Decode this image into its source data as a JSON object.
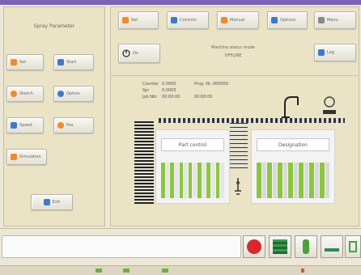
{
  "left_panel": {
    "title": "Spray Parameter",
    "buttons": [
      {
        "label": "Set",
        "icon": "orange-square-icon",
        "color": "#f08a2a"
      },
      {
        "label": "Start",
        "icon": "blue-grid-icon",
        "color": "#3f79c9"
      },
      {
        "label": "Sketch",
        "icon": "orange-half-icon",
        "color": "#f08a2a"
      },
      {
        "label": "Option",
        "icon": "blue-oval-icon",
        "color": "#3f79c9"
      },
      {
        "label": "Speed",
        "icon": "blue-square-icon",
        "color": "#3f79c9"
      },
      {
        "label": "Pos",
        "icon": "orange-dot-icon",
        "color": "#f08a2a"
      },
      {
        "label": "Simulation",
        "icon": "orange-grid-icon",
        "color": "#f08a2a"
      }
    ],
    "bottom_button": "Exit"
  },
  "toolbar": [
    {
      "label": "Set",
      "icon": "orange-icon",
      "color": "#f08a2a"
    },
    {
      "label": "Controls",
      "icon": "blue-icon",
      "color": "#3f79c9"
    },
    {
      "label": "Manual",
      "icon": "orange-icon",
      "color": "#f08a2a"
    },
    {
      "label": "Options",
      "icon": "blue-icon",
      "color": "#3f79c9"
    },
    {
      "label": "Menu",
      "icon": "gray-icon",
      "color": "#888888"
    }
  ],
  "power_button": {
    "label": "On"
  },
  "status": {
    "line1": "Machine status mode",
    "line2": "OFFLINE"
  },
  "logout_button": {
    "label": "Log"
  },
  "info": {
    "rows": [
      {
        "key": "Counter",
        "val": "0.0000",
        "extra": "Prog. Nr. 000000"
      },
      {
        "key": "Spr",
        "val": "0.0000",
        "extra": ""
      },
      {
        "key": "Job Nbr",
        "val": "00:00:00",
        "extra": "00:00:00"
      }
    ]
  },
  "machine_left": {
    "title": "Part control",
    "bars": [
      "#8cc63f",
      "#e6e6e6",
      "#8cc63f",
      "#e6e6e6",
      "#8cc63f",
      "#e6e6e6",
      "#8cc63f",
      "#e6e6e6",
      "#8cc63f",
      "#e6e6e6",
      "#8cc63f",
      "#e6e6e6",
      "#8cc63f",
      "#e6e6e6"
    ]
  },
  "machine_right": {
    "title": "Designation",
    "bars": [
      "#8cc63f",
      "#d9d9d9",
      "#8cc63f",
      "#d9d9d9",
      "#8cc63f",
      "#d9d9d9",
      "#8cc63f",
      "#d9d9d9",
      "#8cc63f",
      "#d9d9d9",
      "#8cc63f",
      "#d9d9d9",
      "#8cc63f",
      "#d9d9d9"
    ]
  },
  "bottom_buttons": [
    {
      "name": "stop-icon",
      "color": "#d9272e"
    },
    {
      "name": "grid-icon",
      "color": "#1c6b2d"
    },
    {
      "name": "tool-icon",
      "color": "#4aa23a"
    },
    {
      "name": "wave-icon",
      "color": "#2e8b57"
    },
    {
      "name": "exchange-icon",
      "color": "#4aa23a"
    }
  ]
}
